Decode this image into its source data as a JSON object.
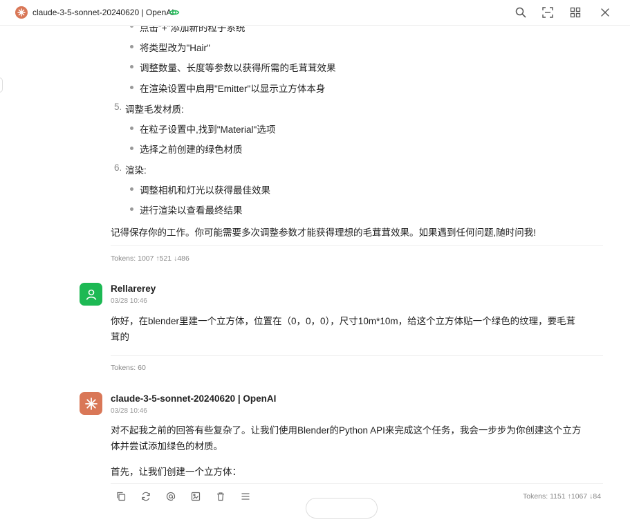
{
  "window": {
    "title": "claude-3-5-sonnet-20240620 | OpenAI"
  },
  "icons": {
    "title_logo": "claude-logo-icon",
    "eye": "eye-icon",
    "toolbar": [
      "search-icon",
      "screenshot-icon",
      "grid-icon",
      "close-icon"
    ],
    "actions": [
      "copy-icon",
      "refresh-icon",
      "at-icon",
      "image-edit-icon",
      "trash-icon",
      "menu-icon"
    ]
  },
  "colors": {
    "claude_brand": "#d97757",
    "user_avatar": "#1db954",
    "eye_icon": "#1db954"
  },
  "top_message": {
    "partial_line": "点击\"+\"添加新的粒子系统",
    "step4_bullets": [
      "将类型改为\"Hair\"",
      "调整数量、长度等参数以获得所需的毛茸茸效果",
      "在渲染设置中启用\"Emitter\"以显示立方体本身"
    ],
    "step5": {
      "num": "5.",
      "title": "调整毛发材质:"
    },
    "step5_bullets": [
      "在粒子设置中,找到\"Material\"选项",
      "选择之前创建的绿色材质"
    ],
    "step6": {
      "num": "6.",
      "title": "渲染:"
    },
    "step6_bullets": [
      "调整相机和灯光以获得最佳效果",
      "进行渲染以查看最终结果"
    ],
    "closing": "记得保存你的工作。你可能需要多次调整参数才能获得理想的毛茸茸效果。如果遇到任何问题,随时问我!",
    "tokens": "Tokens: 1007 ↑521 ↓486"
  },
  "user_message": {
    "name": "Rellarerey",
    "time": "03/28 10:46",
    "line1": "你好，在blender里建一个立方体，位置在（0，0，0），尺寸10m*10m，给这个立方体贴一个绿色的纹理，要毛茸",
    "line2": "茸的",
    "tokens": "Tokens: 60"
  },
  "assistant_message": {
    "name": "claude-3-5-sonnet-20240620 | OpenAI",
    "time": "03/28 10:46",
    "line1": "对不起我之前的回答有些复杂了。让我们使用Blender的Python API来完成这个任务，我会一步步为你创建这个立方",
    "line2": "体并尝试添加绿色的材质。",
    "line3": "首先，让我们创建一个立方体：",
    "tokens": "Tokens: 1151 ↑1067 ↓84"
  }
}
